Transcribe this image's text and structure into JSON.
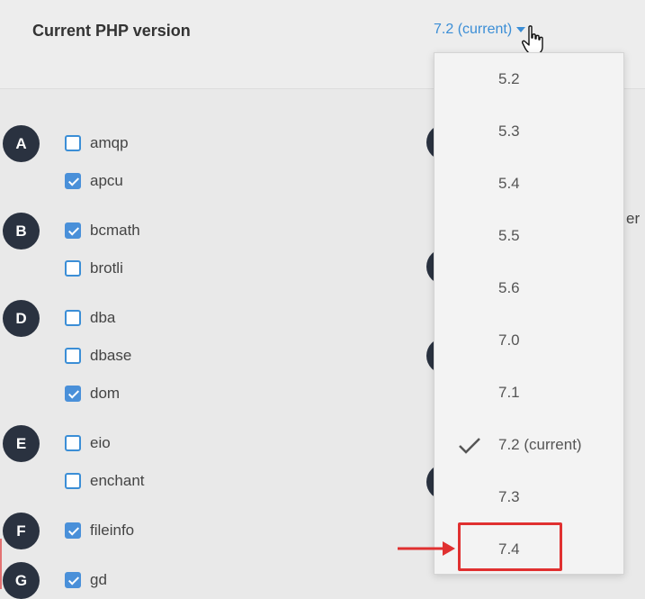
{
  "header": {
    "title": "Current PHP version",
    "current_version": "7.2 (current)"
  },
  "groups": [
    {
      "letter": "A",
      "extensions": [
        {
          "name": "amqp",
          "checked": false
        },
        {
          "name": "apcu",
          "checked": true
        }
      ]
    },
    {
      "letter": "B",
      "extensions": [
        {
          "name": "bcmath",
          "checked": true
        },
        {
          "name": "brotli",
          "checked": false
        }
      ]
    },
    {
      "letter": "D",
      "extensions": [
        {
          "name": "dba",
          "checked": false
        },
        {
          "name": "dbase",
          "checked": false
        },
        {
          "name": "dom",
          "checked": true
        }
      ]
    },
    {
      "letter": "E",
      "extensions": [
        {
          "name": "eio",
          "checked": false
        },
        {
          "name": "enchant",
          "checked": false
        }
      ]
    },
    {
      "letter": "F",
      "extensions": [
        {
          "name": "fileinfo",
          "checked": true
        }
      ]
    },
    {
      "letter": "G",
      "extensions": [
        {
          "name": "gd",
          "checked": true
        }
      ]
    }
  ],
  "dropdown": {
    "options": [
      "5.2",
      "5.3",
      "5.4",
      "5.5",
      "5.6",
      "7.0",
      "7.1",
      "7.2 (current)",
      "7.3",
      "7.4"
    ],
    "selected_index": 7,
    "highlighted_index": 9
  },
  "side_text": "er",
  "colors": {
    "accent": "#3b8ed6",
    "badge": "#2a3240",
    "highlight": "#e03030"
  }
}
